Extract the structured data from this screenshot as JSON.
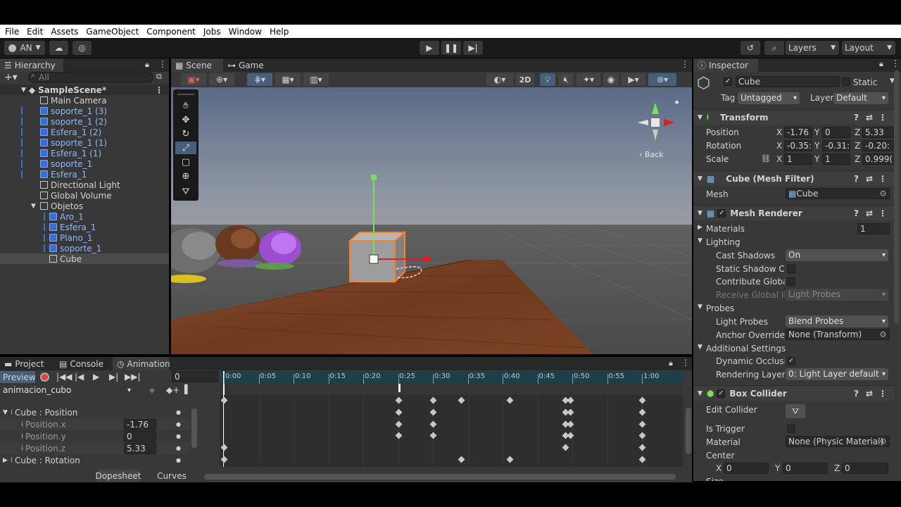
{
  "menu": [
    "File",
    "Edit",
    "Assets",
    "GameObject",
    "Component",
    "Jobs",
    "Window",
    "Help"
  ],
  "toolbar": {
    "account": "AN",
    "layers": "Layers",
    "layout": "Layout"
  },
  "hierarchy": {
    "tab": "Hierarchy",
    "search_placeholder": "All",
    "scene": "SampleScene*",
    "items": [
      {
        "label": "Main Camera",
        "indent": 1,
        "blue": false
      },
      {
        "label": "soporte_1 (3)",
        "indent": 1,
        "blue": true
      },
      {
        "label": "soporte_1 (2)",
        "indent": 1,
        "blue": true
      },
      {
        "label": "Esfera_1 (2)",
        "indent": 1,
        "blue": true
      },
      {
        "label": "soporte_1 (1)",
        "indent": 1,
        "blue": true
      },
      {
        "label": "Esfera_1 (1)",
        "indent": 1,
        "blue": true
      },
      {
        "label": "soporte_1",
        "indent": 1,
        "blue": true
      },
      {
        "label": "Esfera_1",
        "indent": 1,
        "blue": true
      },
      {
        "label": "Directional Light",
        "indent": 1,
        "blue": false
      },
      {
        "label": "Global Volume",
        "indent": 1,
        "blue": false
      },
      {
        "label": "Objetos",
        "indent": 1,
        "blue": false
      },
      {
        "label": "Aro_1",
        "indent": 2,
        "blue": true
      },
      {
        "label": "Esfera_1",
        "indent": 2,
        "blue": true
      },
      {
        "label": "Plano_1",
        "indent": 2,
        "blue": true
      },
      {
        "label": "soporte_1",
        "indent": 2,
        "blue": true
      },
      {
        "label": "Cube",
        "indent": 2,
        "blue": false
      }
    ]
  },
  "scene_tabs": {
    "scene": "Scene",
    "game": "Game",
    "mode_2d": "2D",
    "back": "Back"
  },
  "inspector": {
    "tab": "Inspector",
    "object_name": "Cube",
    "static": "Static",
    "tag_label": "Tag",
    "tag": "Untagged",
    "layer_label": "Layer",
    "layer": "Default",
    "transform": {
      "title": "Transform",
      "position": "Position",
      "rotation": "Rotation",
      "scale": "Scale",
      "pos": [
        "-1.76",
        "0",
        "5.33"
      ],
      "rot": [
        "-0.35:",
        "-0.31:",
        "-0.20:"
      ],
      "scl": [
        "1",
        "1",
        "0.999("
      ]
    },
    "mesh_filter": {
      "title": "Cube (Mesh Filter)",
      "mesh_label": "Mesh",
      "mesh": "Cube"
    },
    "mesh_renderer": {
      "title": "Mesh Renderer",
      "materials": "Materials",
      "materials_count": "1",
      "lighting": "Lighting",
      "cast_shadows": "Cast Shadows",
      "cast_shadows_val": "On",
      "static_shadow": "Static Shadow Cas",
      "contribute_gi": "Contribute Global I",
      "receive_gi": "Receive Global Illu",
      "receive_gi_val": "Light Probes",
      "probes": "Probes",
      "light_probes": "Light Probes",
      "light_probes_val": "Blend Probes",
      "anchor": "Anchor Override",
      "anchor_val": "None (Transform)",
      "additional": "Additional Settings",
      "dynamic_occ": "Dynamic Occlusioi",
      "rendering_layer": "Rendering Layer M",
      "rendering_layer_val": "0: Light Layer default"
    },
    "box_collider": {
      "title": "Box Collider",
      "edit": "Edit Collider",
      "trigger": "Is Trigger",
      "material": "Material",
      "material_val": "None (Physic Material)",
      "center": "Center",
      "center_vals": [
        "0",
        "0",
        "0"
      ],
      "size": "Size"
    },
    "axes": [
      "X",
      "Y",
      "Z"
    ]
  },
  "bottom": {
    "tabs": [
      "Project",
      "Console",
      "Animation"
    ],
    "preview": "Preview",
    "frame": "0",
    "clip": "animacion_cubo",
    "props": [
      {
        "label": "Cube : Position",
        "value": "",
        "header": true
      },
      {
        "label": "Position.x",
        "value": "-1.76",
        "header": false
      },
      {
        "label": "Position.y",
        "value": "0",
        "header": false
      },
      {
        "label": "Position.z",
        "value": "5.33",
        "header": false
      },
      {
        "label": "Cube : Rotation",
        "value": "",
        "header": true
      }
    ],
    "ruler": [
      "0:00",
      "0:05",
      "0:10",
      "0:15",
      "0:20",
      "0:25",
      "0:30",
      "0:35",
      "0:40",
      "0:45",
      "0:50",
      "0:55",
      "1:00"
    ],
    "dopesheet": "Dopesheet",
    "curves": "Curves"
  }
}
